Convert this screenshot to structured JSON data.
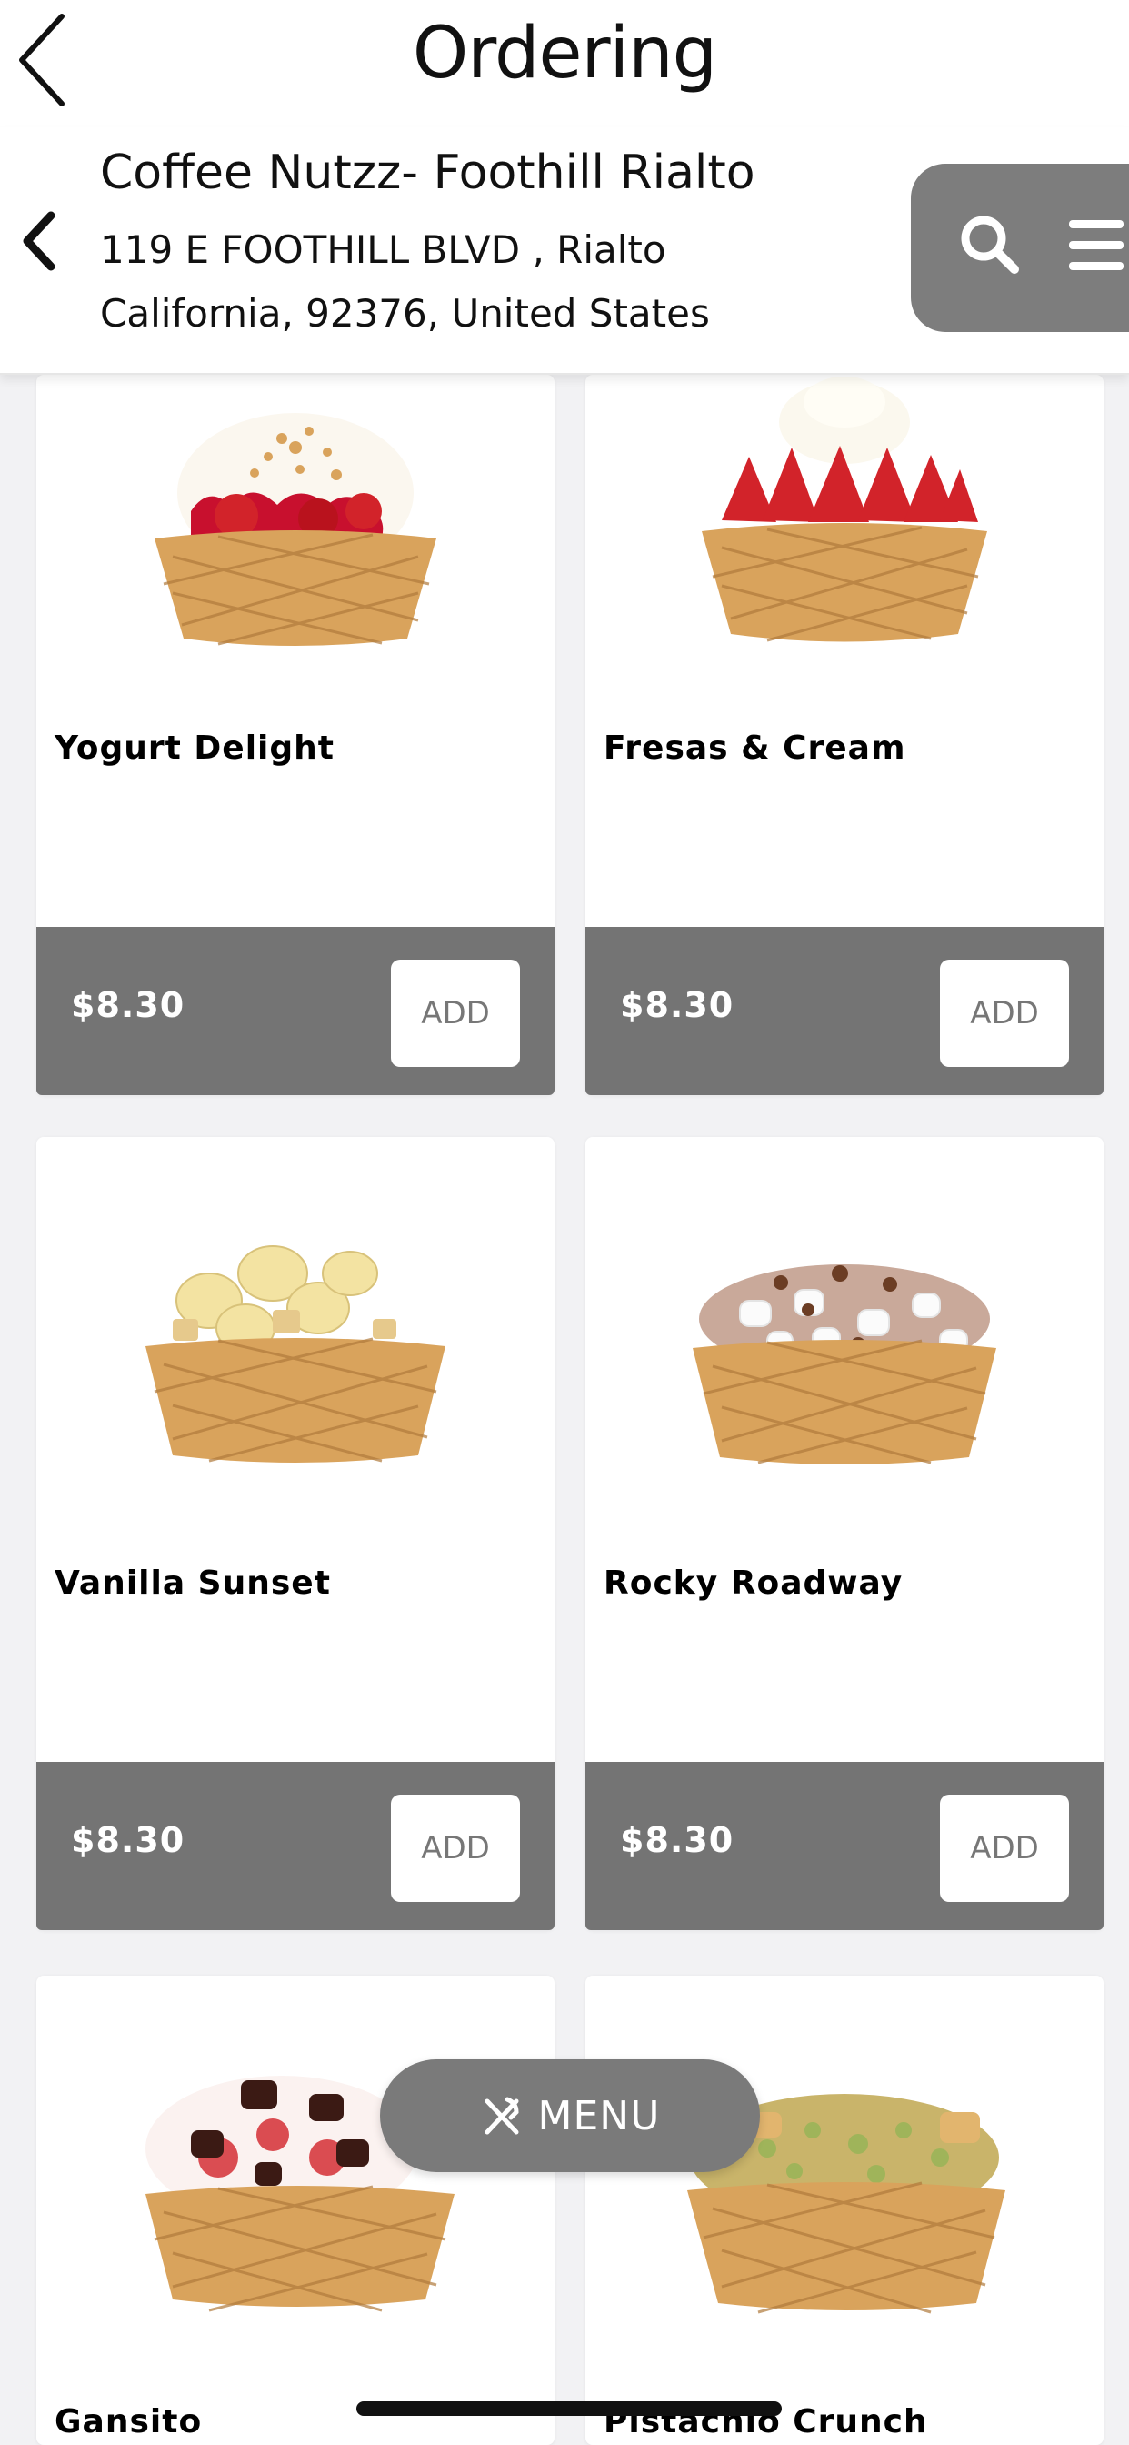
{
  "header": {
    "title": "Ordering"
  },
  "store": {
    "name": "Coffee Nutzz- Foothill Rialto",
    "address_line1": "119 E FOOTHILL BLVD , Rialto",
    "address_line2": "California, 92376, United States"
  },
  "icons": {
    "back": "chevron-left-icon",
    "store_back": "chevron-left-icon",
    "search": "search-icon",
    "menu": "hamburger-icon",
    "fab": "utensils-icon"
  },
  "products": [
    {
      "name": "Yogurt Delight",
      "price": "$8.30",
      "add_label": "ADD"
    },
    {
      "name": "Fresas & Cream",
      "price": "$8.30",
      "add_label": "ADD"
    },
    {
      "name": "Vanilla Sunset",
      "price": "$8.30",
      "add_label": "ADD"
    },
    {
      "name": "Rocky Roadway",
      "price": "$8.30",
      "add_label": "ADD"
    },
    {
      "name": "Gansito",
      "price": "",
      "add_label": ""
    },
    {
      "name": "Pistachio Crunch",
      "price": "",
      "add_label": ""
    }
  ],
  "menu_button": {
    "label": "MENU"
  },
  "colors": {
    "footer_bg": "#747474",
    "pill_bg": "#7d7d7d",
    "waffle": "#d9a35c",
    "strawberry": "#d2232a"
  }
}
